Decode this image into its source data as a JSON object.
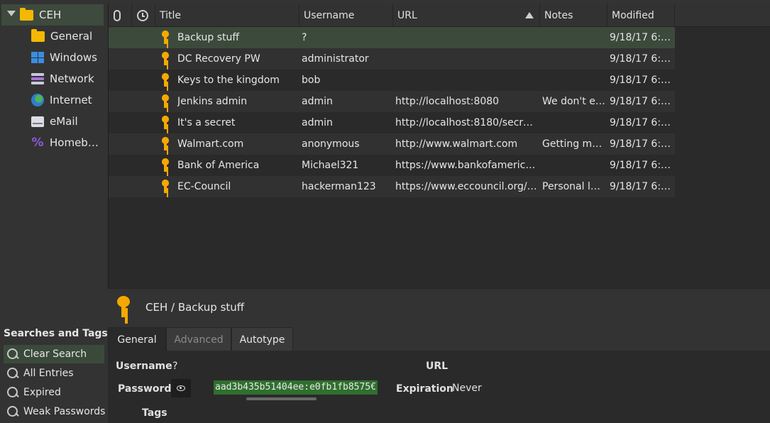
{
  "sidebar": {
    "root_group": "CEH",
    "groups": [
      {
        "label": "General",
        "icon": "folder-icon"
      },
      {
        "label": "Windows",
        "icon": "windows-icon"
      },
      {
        "label": "Network",
        "icon": "network-icon"
      },
      {
        "label": "Internet",
        "icon": "globe-icon"
      },
      {
        "label": "eMail",
        "icon": "mail-icon"
      },
      {
        "label": "Homeb…",
        "icon": "percent-icon"
      }
    ],
    "searches_title": "Searches and Tags",
    "searches": [
      {
        "label": "Clear Search"
      },
      {
        "label": "All Entries"
      },
      {
        "label": "Expired"
      },
      {
        "label": "Weak Passwords"
      }
    ]
  },
  "table": {
    "headers": {
      "attachment": "paperclip-icon",
      "expiry": "clock-icon",
      "title": "Title",
      "username": "Username",
      "url": "URL",
      "notes": "Notes",
      "modified": "Modified"
    },
    "sort_column": "url",
    "sort_direction": "ascending",
    "rows": [
      {
        "title": "Backup stuff",
        "username": "?",
        "url": "",
        "notes": "",
        "modified": "9/18/17 6:4…"
      },
      {
        "title": "DC Recovery PW",
        "username": "administrator",
        "url": "",
        "notes": "",
        "modified": "9/18/17 6:4…"
      },
      {
        "title": "Keys to the kingdom",
        "username": "bob",
        "url": "",
        "notes": "",
        "modified": "9/18/17 6:4…"
      },
      {
        "title": "Jenkins admin",
        "username": "admin",
        "url": "http://localhost:8080",
        "notes": "We don't e…",
        "modified": "9/18/17 6:4…"
      },
      {
        "title": "It's a secret",
        "username": "admin",
        "url": "http://localhost:8180/secret…",
        "notes": "",
        "modified": "9/18/17 6:3…"
      },
      {
        "title": "Walmart.com",
        "username": "anonymous",
        "url": "http://www.walmart.com",
        "notes": "Getting my…",
        "modified": "9/18/17 6:3…"
      },
      {
        "title": "Bank of America",
        "username": "Michael321",
        "url": "https://www.bankofameric…",
        "notes": "",
        "modified": "9/18/17 6:3…"
      },
      {
        "title": "EC-Council",
        "username": "hackerman123",
        "url": "https://www.eccouncil.org/…",
        "notes": "Personal l…",
        "modified": "9/18/17 6:4…"
      }
    ]
  },
  "detail": {
    "title": "CEH / Backup stuff",
    "tabs": [
      {
        "label": "General",
        "state": "active"
      },
      {
        "label": "Advanced",
        "state": "disabled"
      },
      {
        "label": "Autotype",
        "state": "normal"
      }
    ],
    "fields": {
      "username_label": "Username",
      "username_value": "?",
      "password_label": "Password",
      "password_value": "aad3b435b51404ee:e0fb1fb8575€",
      "url_label": "URL",
      "expiration_label": "Expiration",
      "expiration_value": "Never",
      "tags_label": "Tags"
    }
  },
  "colors": {
    "background": "#333333",
    "table_background": "#2a2a2a",
    "selection": "#3c4a3c",
    "key_icon": "#f5a800",
    "password_highlight": "#2f6f2f"
  }
}
